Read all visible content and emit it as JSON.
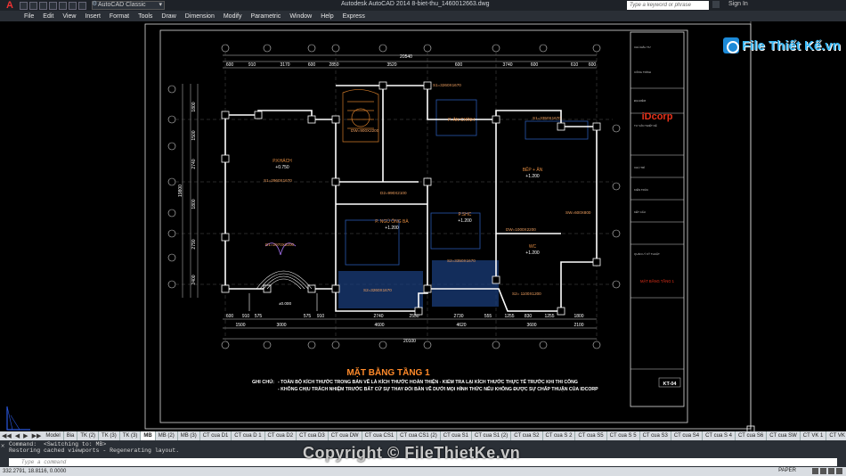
{
  "titlebar": {
    "app_logo": "A",
    "workspace": "AutoCAD Classic",
    "title": "Autodesk AutoCAD 2014   8-biet-thu_1460012663.dwg",
    "search_placeholder": "Type a keyword or phrase",
    "signin": "Sign In"
  },
  "menu": [
    "File",
    "Edit",
    "View",
    "Insert",
    "Format",
    "Tools",
    "Draw",
    "Dimension",
    "Modify",
    "Parametric",
    "Window",
    "Help",
    "Express"
  ],
  "watermark": {
    "brand": "File Thiết Kế.vn"
  },
  "drawing": {
    "top_total": "20540",
    "top_dims": [
      "600",
      "910",
      "3170",
      "600",
      "2850",
      "3520",
      "600",
      "3740",
      "600",
      "610",
      "600"
    ],
    "bottom_dims_1": [
      "600",
      "910",
      "575",
      "575",
      "910",
      "2740",
      "2550",
      "2730",
      "555",
      "1255",
      "830",
      "1255",
      "1800"
    ],
    "bottom_dims_2": [
      "1500",
      "3000",
      "4600",
      "4620",
      "3600",
      "2100"
    ],
    "bottom_total": "20100",
    "left_total": "19800",
    "left_dims": [
      "1800",
      "1500",
      "2740",
      "1800",
      "2790",
      "2400"
    ],
    "rooms": [
      {
        "label": "P.KHÁCH",
        "elev": "+0.750"
      },
      {
        "label": "P. ĂN CHÍNH",
        "elev": ""
      },
      {
        "label": "BẾP + ĂN",
        "elev": "+1.200"
      },
      {
        "label": "P. NGỦ ÔNG BÀ",
        "elev": "+1.200"
      },
      {
        "label": "P.SHC",
        "elev": "+1.200"
      },
      {
        "label": "WC",
        "elev": "+1.200"
      }
    ],
    "doors": [
      "S1=3260X1670",
      "S1=2960X1670",
      "D1=2970X2200",
      "D2=990X2100",
      "DW=900X2200",
      "S1=3350X1670",
      "S2=3260X1670",
      "S2= 1100X1200",
      "SW=600X800",
      "S2=3350X1670",
      "DW=1000X2200"
    ],
    "elevations": [
      "+1.200",
      "±0.000",
      "+1.200"
    ],
    "plan_title": "MẶT BẰNG TẦNG 1",
    "notes_label": "GHI CHÚ:",
    "notes": [
      "- TOÀN BỘ KÍCH THƯỚC TRONG BẢN VẼ LÀ KÍCH THƯỚC HOÀN THIỆN - KIỂM TRA LẠI KÍCH THƯỚC THỰC TẾ TRƯỚC KHI THI CÔNG",
      "- KHÔNG CHỊU TRÁCH NHIỆM TRƯỚC BẤT CỨ SỰ THAY ĐỔI BẢN VẼ DƯỚI MỌI HÌNH THỨC NẾU KHÔNG ĐƯỢC SỰ CHẤP THUẬN CỦA IDCORP"
    ]
  },
  "titleblock": {
    "company": "iDcorp",
    "sheet_title": "MẶT BẰNG TẦNG 1",
    "sheet_no": "KT-04",
    "rows": [
      "CHỦ ĐẦU TƯ",
      "CÔNG TRÌNH",
      "ĐỊA ĐIỂM",
      "TƯ VẤN THIẾT KẾ",
      "CHỦ TRÌ",
      "KIẾN TRÚC",
      "KẾT CẤU",
      "QUẢN LÝ KỸ THUẬT"
    ]
  },
  "tabs": [
    "Model",
    "Bia",
    "TK (2)",
    "TK (3)",
    "TK (3)",
    "MB",
    "MB (2)",
    "MB (3)",
    "CT cua D1",
    "CT cua D 1",
    "CT cua D2",
    "CT cua D3",
    "CT cua DW",
    "CT cua CS1",
    "CT cua CS1 (2)",
    "CT cua S1",
    "CT cua S1 (2)",
    "CT cua S2",
    "CT cua S 2",
    "CT cua S5",
    "CT cua S 5",
    "CT cua S3",
    "CT cua S4",
    "CT cua S 4",
    "CT cua S6",
    "CT cua SW",
    "CT VK 1",
    "CT VK 1",
    "CT VK"
  ],
  "active_tab": 5,
  "command": {
    "line1": "Command:  <Switching to: MB>",
    "line2": "Restoring cached viewports - Regenerating layout.",
    "placeholder": "Type a command"
  },
  "copyright": "Copyright © FileThietKe.vn",
  "status": {
    "coords": "332.2791, 18.8116, 0.0000",
    "paper": "PAPER"
  }
}
